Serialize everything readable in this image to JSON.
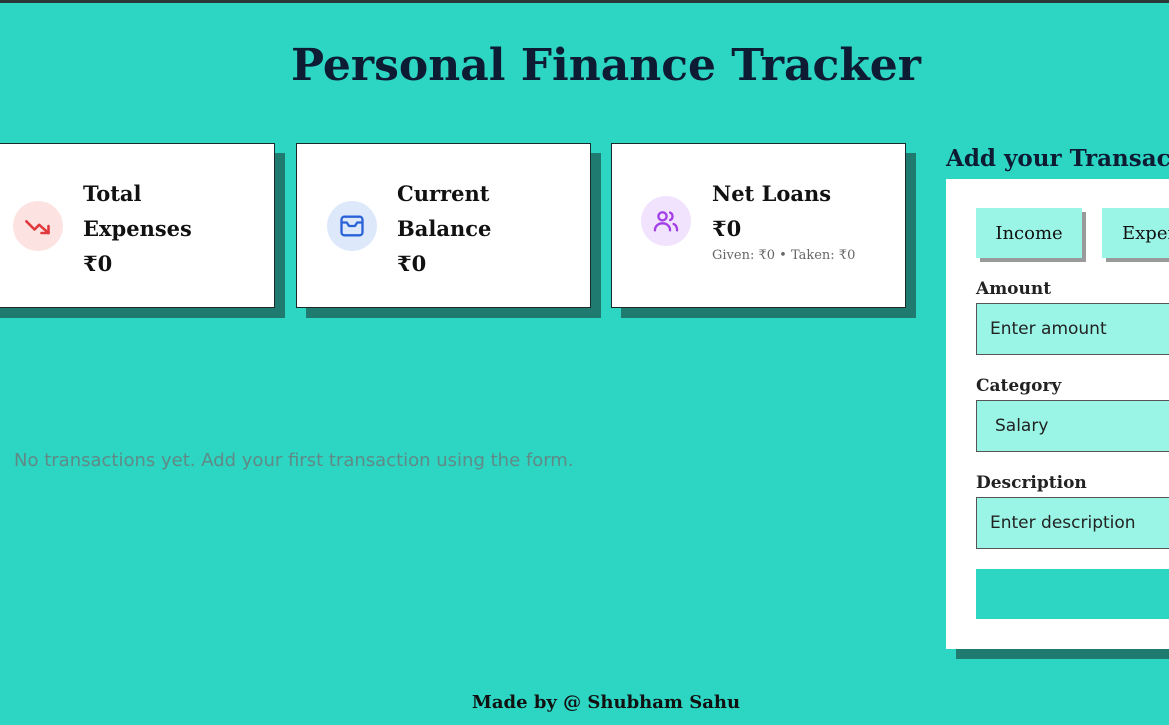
{
  "app": {
    "title": "Personal Finance Tracker"
  },
  "cards": [
    {
      "label": "Total Expenses",
      "value": "₹0",
      "icon": "trending-down-icon"
    },
    {
      "label": "Current Balance",
      "value": "₹0",
      "icon": "wallet-icon"
    },
    {
      "label": "Net Loans",
      "value": "₹0",
      "sub": "Given: ₹0 • Taken: ₹0",
      "icon": "users-icon"
    }
  ],
  "transactions": {
    "empty_message": "No transactions yet. Add your first transaction using the form."
  },
  "form": {
    "title": "Add your Transaction",
    "type_options": [
      "Income",
      "Expense"
    ],
    "amount_label": "Amount",
    "amount_placeholder": "Enter amount",
    "category_label": "Category",
    "category_value": "Salary",
    "description_label": "Description",
    "description_placeholder": "Enter description",
    "submit_icon": "plus-circle-icon"
  },
  "footer": {
    "text": "Made by @ Shubham Sahu"
  },
  "colors": {
    "background": "#2dd5c3",
    "input_bg": "#9af5e6",
    "shadow": "#1f7a70"
  }
}
